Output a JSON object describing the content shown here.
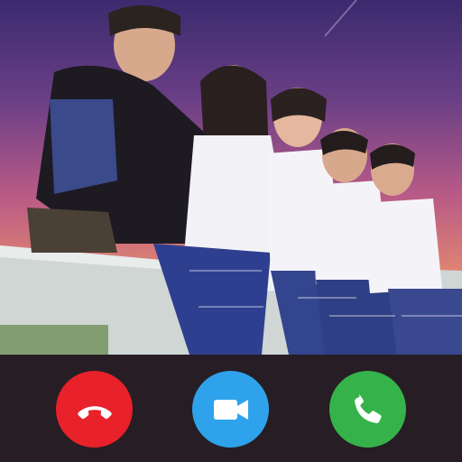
{
  "call_screen": {
    "caller_photo": {
      "icon": "group-photo"
    },
    "actions": {
      "decline": {
        "icon": "phone-hangup-icon",
        "color": "#e8212b"
      },
      "video": {
        "icon": "video-camera-icon",
        "color": "#2ea3ec"
      },
      "accept": {
        "icon": "phone-icon",
        "color": "#35b34a"
      }
    },
    "colors": {
      "background": "#261e24",
      "icon_foreground": "#ffffff"
    }
  }
}
